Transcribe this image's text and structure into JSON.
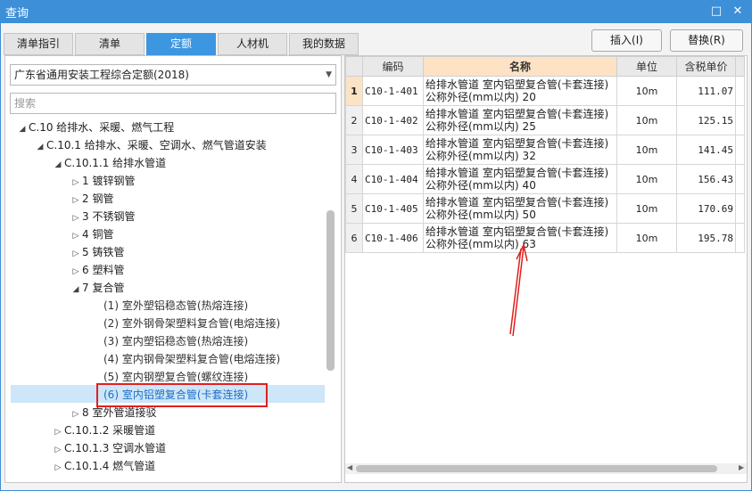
{
  "window": {
    "title": "查询",
    "restore_icon": "restore-icon",
    "close_icon": "close-icon"
  },
  "tabs": [
    {
      "label": "清单指引",
      "active": false
    },
    {
      "label": "清单",
      "active": false
    },
    {
      "label": "定额",
      "active": true
    },
    {
      "label": "人材机",
      "active": false
    },
    {
      "label": "我的数据",
      "active": false
    }
  ],
  "actions": {
    "insert": "插入(I)",
    "replace": "替换(R)"
  },
  "left": {
    "library": "广东省通用安装工程综合定额(2018)",
    "search_placeholder": "搜索",
    "tree": [
      {
        "label": "C.10 给排水、采暖、燃气工程",
        "arrow": "◢"
      },
      {
        "label": "C.10.1 给排水、采暖、空调水、燃气管道安装",
        "arrow": "◢"
      },
      {
        "label": "C.10.1.1 给排水管道",
        "arrow": "◢"
      },
      {
        "label": "1 镀锌钢管",
        "arrow": "▷"
      },
      {
        "label": "2 钢管",
        "arrow": "▷"
      },
      {
        "label": "3 不锈钢管",
        "arrow": "▷"
      },
      {
        "label": "4 铜管",
        "arrow": "▷"
      },
      {
        "label": "5 铸铁管",
        "arrow": "▷"
      },
      {
        "label": "6 塑料管",
        "arrow": "▷"
      },
      {
        "label": "7 复合管",
        "arrow": "◢"
      },
      {
        "label": "(1) 室外塑铝稳态管(热熔连接)",
        "arrow": ""
      },
      {
        "label": "(2) 室外钢骨架塑料复合管(电熔连接)",
        "arrow": ""
      },
      {
        "label": "(3) 室内塑铝稳态管(热熔连接)",
        "arrow": ""
      },
      {
        "label": "(4) 室内钢骨架塑料复合管(电熔连接)",
        "arrow": ""
      },
      {
        "label": "(5) 室内钢塑复合管(螺纹连接)",
        "arrow": ""
      },
      {
        "label": "(6) 室内铝塑复合管(卡套连接)",
        "arrow": ""
      },
      {
        "label": "8 室外管道接驳",
        "arrow": "▷"
      },
      {
        "label": "C.10.1.2 采暖管道",
        "arrow": "▷"
      },
      {
        "label": "C.10.1.3 空调水管道",
        "arrow": "▷"
      },
      {
        "label": "C.10.1.4 燃气管道",
        "arrow": "▷"
      }
    ]
  },
  "grid": {
    "headers": {
      "code": "编码",
      "name": "名称",
      "unit": "单位",
      "price": "含税单价"
    },
    "rows": [
      {
        "idx": "1",
        "code": "C10-1-401",
        "name1": "给排水管道 室内铝塑复合管(卡套连接)",
        "name2": "公称外径(mm以内) 20",
        "unit": "10m",
        "price": "111.07"
      },
      {
        "idx": "2",
        "code": "C10-1-402",
        "name1": "给排水管道 室内铝塑复合管(卡套连接)",
        "name2": "公称外径(mm以内) 25",
        "unit": "10m",
        "price": "125.15"
      },
      {
        "idx": "3",
        "code": "C10-1-403",
        "name1": "给排水管道 室内铝塑复合管(卡套连接)",
        "name2": "公称外径(mm以内) 32",
        "unit": "10m",
        "price": "141.45"
      },
      {
        "idx": "4",
        "code": "C10-1-404",
        "name1": "给排水管道 室内铝塑复合管(卡套连接)",
        "name2": "公称外径(mm以内) 40",
        "unit": "10m",
        "price": "156.43"
      },
      {
        "idx": "5",
        "code": "C10-1-405",
        "name1": "给排水管道 室内铝塑复合管(卡套连接)",
        "name2": "公称外径(mm以内) 50",
        "unit": "10m",
        "price": "170.69"
      },
      {
        "idx": "6",
        "code": "C10-1-406",
        "name1": "给排水管道 室内铝塑复合管(卡套连接)",
        "name2": "公称外径(mm以内) 63",
        "unit": "10m",
        "price": "195.78"
      }
    ]
  },
  "colors": {
    "titlebar": "#3d8fd8",
    "active_tab": "#3d96e0",
    "highlight_box": "#e02020",
    "annotation_arrow": "#e02020"
  }
}
